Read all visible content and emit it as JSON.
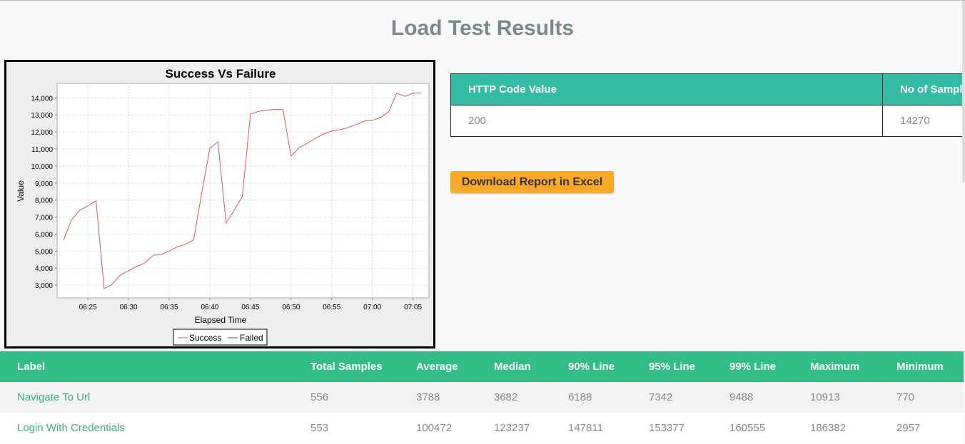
{
  "page": {
    "title": "Load Test Results"
  },
  "chart_data": {
    "type": "line",
    "title": "Success Vs Failure",
    "xlabel": "Elapsed Time",
    "ylabel": "Value",
    "x": [
      "06:22",
      "06:23",
      "06:24",
      "06:25",
      "06:26",
      "06:27",
      "06:28",
      "06:29",
      "06:30",
      "06:31",
      "06:32",
      "06:33",
      "06:34",
      "06:35",
      "06:36",
      "06:37",
      "06:38",
      "06:39",
      "06:40",
      "06:41",
      "06:42",
      "06:43",
      "06:44",
      "06:45",
      "06:46",
      "06:47",
      "06:48",
      "06:49",
      "06:50",
      "06:51",
      "06:52",
      "06:53",
      "06:54",
      "06:55",
      "06:56",
      "06:57",
      "06:58",
      "06:59",
      "07:00",
      "07:01",
      "07:02",
      "07:03",
      "07:04",
      "07:05",
      "07:06"
    ],
    "series": [
      {
        "name": "Success",
        "color": "#e8505b",
        "values": [
          5650,
          6850,
          7400,
          7650,
          7950,
          2800,
          3050,
          3600,
          3850,
          4100,
          4300,
          4750,
          4800,
          5000,
          5250,
          5400,
          5650,
          8400,
          11050,
          11420,
          6650,
          7400,
          8200,
          13050,
          13200,
          13280,
          13320,
          13320,
          10580,
          11080,
          11330,
          11630,
          11880,
          12050,
          12130,
          12250,
          12430,
          12630,
          12680,
          12850,
          13180,
          14270,
          14090,
          14270,
          14300
        ]
      },
      {
        "name": "Failed",
        "color": "#4a4adf",
        "values": []
      }
    ],
    "x_ticks": [
      "06:25",
      "06:30",
      "06:35",
      "06:40",
      "06:45",
      "06:50",
      "06:55",
      "07:00",
      "07:05"
    ],
    "y_ticks": [
      "3,000",
      "4,000",
      "5,000",
      "6,000",
      "7,000",
      "8,000",
      "9,000",
      "10,000",
      "11,000",
      "12,000",
      "13,000",
      "14,000"
    ],
    "ylim": [
      2250,
      14850
    ],
    "grid": true,
    "legend": "bottom"
  },
  "http_codes": {
    "headers": [
      "HTTP Code Value",
      "No of Samples"
    ],
    "rows": [
      [
        "200",
        "14270"
      ]
    ]
  },
  "download_button": {
    "label": "Download Report in Excel",
    "color": "#f9a926"
  },
  "results": {
    "headers": [
      "Label",
      "Total Samples",
      "Average",
      "Median",
      "90% Line",
      "95% Line",
      "99% Line",
      "Maximum",
      "Minimum"
    ],
    "rows": [
      [
        "Navigate To Url",
        "556",
        "3788",
        "3682",
        "6188",
        "7342",
        "9488",
        "10913",
        "770"
      ],
      [
        "Login With Credentials",
        "553",
        "100472",
        "123237",
        "147811",
        "153377",
        "160555",
        "186382",
        "2957"
      ]
    ]
  }
}
